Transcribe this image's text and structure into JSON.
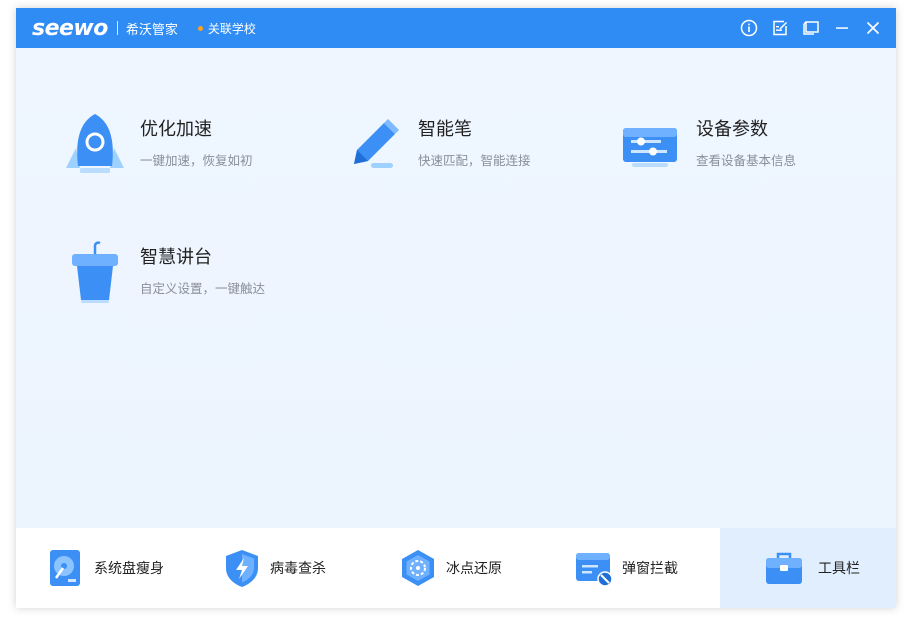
{
  "titlebar": {
    "logo": "seewo",
    "app_name": "希沃管家",
    "school": "关联学校",
    "controls": [
      "info-icon",
      "feedback-icon",
      "skin-icon",
      "minimize-icon",
      "close-icon"
    ]
  },
  "features": [
    {
      "title": "优化加速",
      "desc": "一键加速，恢复如初",
      "icon": "rocket-icon"
    },
    {
      "title": "智能笔",
      "desc": "快速匹配，智能连接",
      "icon": "pen-icon"
    },
    {
      "title": "设备参数",
      "desc": "查看设备基本信息",
      "icon": "device-settings-icon"
    },
    {
      "title": "智慧讲台",
      "desc": "自定义设置，一键触达",
      "icon": "podium-icon"
    }
  ],
  "tools": [
    {
      "label": "系统盘瘦身",
      "icon": "disk-cleanup-icon"
    },
    {
      "label": "病毒查杀",
      "icon": "shield-icon"
    },
    {
      "label": "冰点还原",
      "icon": "freeze-restore-icon"
    },
    {
      "label": "弹窗拦截",
      "icon": "popup-block-icon"
    },
    {
      "label": "工具栏",
      "icon": "toolbox-icon",
      "active": true
    }
  ],
  "colors": {
    "titlebar": "#2f8cf5",
    "accent_dot": "#ffa21a",
    "content_bg": "#eef5fe",
    "active_tool_bg": "#e0eefd"
  }
}
